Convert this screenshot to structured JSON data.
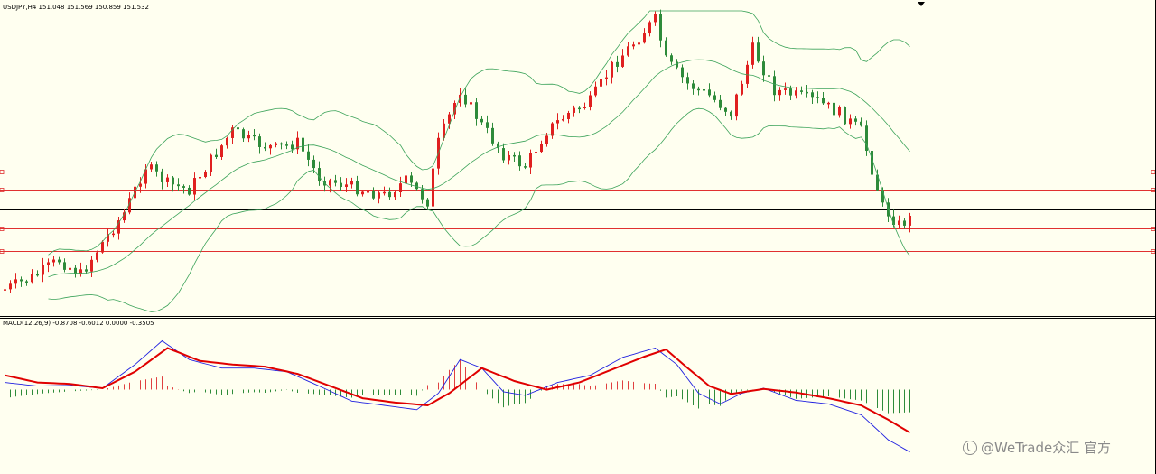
{
  "main_pane": {
    "title": "USDJPY,H4  151.048 151.569 150.859 151.532"
  },
  "macd_pane": {
    "title": "MACD(12,26,9) -0.8708 -0.6012 0.0000 -0.3505"
  },
  "watermark": {
    "text": "@WeTrade众汇 官方",
    "icon": "wetrade-logo-icon"
  },
  "colors": {
    "background": "#fffff0",
    "bull_candle": "#e02020",
    "bear_candle": "#2e8b3a",
    "bollinger": "#3ca35a",
    "level_line": "#e03030",
    "current_price_line": "#000000",
    "macd_line": "#2020e0",
    "signal_line": "#e00000",
    "hist_pos": "#e04040",
    "hist_neg": "#2e8b3a"
  },
  "chart_data": [
    {
      "type": "candlestick",
      "symbol": "USDJPY",
      "timeframe": "H4",
      "ohlc_last": {
        "open": 151.048,
        "high": 151.569,
        "low": 150.859,
        "close": 151.532
      },
      "overlay": "Bollinger Bands",
      "horizontal_levels_px_tags": [
        "level-1",
        "level-2",
        "current-price",
        "level-3",
        "level-4"
      ],
      "trend_path": [
        {
          "t": 0,
          "c": 0.06
        },
        {
          "t": 5,
          "c": 0.1
        },
        {
          "t": 10,
          "c": 0.16
        },
        {
          "t": 14,
          "c": 0.11
        },
        {
          "t": 18,
          "c": 0.22
        },
        {
          "t": 22,
          "c": 0.32
        },
        {
          "t": 26,
          "c": 0.48
        },
        {
          "t": 30,
          "c": 0.42
        },
        {
          "t": 34,
          "c": 0.4
        },
        {
          "t": 38,
          "c": 0.5
        },
        {
          "t": 42,
          "c": 0.6
        },
        {
          "t": 46,
          "c": 0.56
        },
        {
          "t": 50,
          "c": 0.54
        },
        {
          "t": 54,
          "c": 0.56
        },
        {
          "t": 58,
          "c": 0.44
        },
        {
          "t": 62,
          "c": 0.42
        },
        {
          "t": 66,
          "c": 0.4
        },
        {
          "t": 70,
          "c": 0.38
        },
        {
          "t": 74,
          "c": 0.43
        },
        {
          "t": 78,
          "c": 0.36
        },
        {
          "t": 80,
          "c": 0.56
        },
        {
          "t": 84,
          "c": 0.74
        },
        {
          "t": 88,
          "c": 0.62
        },
        {
          "t": 92,
          "c": 0.52
        },
        {
          "t": 96,
          "c": 0.48
        },
        {
          "t": 100,
          "c": 0.6
        },
        {
          "t": 104,
          "c": 0.66
        },
        {
          "t": 108,
          "c": 0.7
        },
        {
          "t": 112,
          "c": 0.82
        },
        {
          "t": 116,
          "c": 0.9
        },
        {
          "t": 120,
          "c": 0.98
        },
        {
          "t": 122,
          "c": 0.84
        },
        {
          "t": 126,
          "c": 0.76
        },
        {
          "t": 130,
          "c": 0.72
        },
        {
          "t": 134,
          "c": 0.66
        },
        {
          "t": 138,
          "c": 0.88
        },
        {
          "t": 142,
          "c": 0.74
        },
        {
          "t": 146,
          "c": 0.72
        },
        {
          "t": 150,
          "c": 0.7
        },
        {
          "t": 154,
          "c": 0.66
        },
        {
          "t": 158,
          "c": 0.6
        },
        {
          "t": 162,
          "c": 0.34
        },
        {
          "t": 165,
          "c": 0.28
        },
        {
          "t": 167,
          "c": 0.3
        }
      ]
    },
    {
      "type": "line+histogram",
      "indicator": "MACD",
      "params": [
        12,
        26,
        9
      ],
      "values": {
        "macd": -0.8708,
        "signal": -0.6012,
        "hist": -0.3505
      },
      "macd_path": [
        {
          "t": 0,
          "v": 0.1
        },
        {
          "t": 6,
          "v": 0.05
        },
        {
          "t": 12,
          "v": 0.06
        },
        {
          "t": 18,
          "v": 0.02
        },
        {
          "t": 24,
          "v": 0.35
        },
        {
          "t": 29,
          "v": 0.68
        },
        {
          "t": 34,
          "v": 0.42
        },
        {
          "t": 40,
          "v": 0.3
        },
        {
          "t": 46,
          "v": 0.3
        },
        {
          "t": 52,
          "v": 0.25
        },
        {
          "t": 58,
          "v": 0.05
        },
        {
          "t": 64,
          "v": -0.16
        },
        {
          "t": 70,
          "v": -0.22
        },
        {
          "t": 76,
          "v": -0.28
        },
        {
          "t": 80,
          "v": -0.05
        },
        {
          "t": 84,
          "v": 0.42
        },
        {
          "t": 88,
          "v": 0.3
        },
        {
          "t": 92,
          "v": -0.03
        },
        {
          "t": 96,
          "v": -0.08
        },
        {
          "t": 102,
          "v": 0.1
        },
        {
          "t": 108,
          "v": 0.2
        },
        {
          "t": 114,
          "v": 0.45
        },
        {
          "t": 120,
          "v": 0.58
        },
        {
          "t": 124,
          "v": 0.35
        },
        {
          "t": 128,
          "v": -0.05
        },
        {
          "t": 132,
          "v": -0.2
        },
        {
          "t": 136,
          "v": -0.05
        },
        {
          "t": 140,
          "v": 0.02
        },
        {
          "t": 146,
          "v": -0.15
        },
        {
          "t": 152,
          "v": -0.2
        },
        {
          "t": 158,
          "v": -0.35
        },
        {
          "t": 163,
          "v": -0.7
        },
        {
          "t": 167,
          "v": -0.87
        }
      ],
      "signal_path": [
        {
          "t": 0,
          "v": 0.2
        },
        {
          "t": 6,
          "v": 0.1
        },
        {
          "t": 12,
          "v": 0.08
        },
        {
          "t": 18,
          "v": 0.02
        },
        {
          "t": 24,
          "v": 0.25
        },
        {
          "t": 30,
          "v": 0.58
        },
        {
          "t": 36,
          "v": 0.4
        },
        {
          "t": 42,
          "v": 0.35
        },
        {
          "t": 48,
          "v": 0.32
        },
        {
          "t": 54,
          "v": 0.22
        },
        {
          "t": 60,
          "v": 0.05
        },
        {
          "t": 66,
          "v": -0.12
        },
        {
          "t": 72,
          "v": -0.18
        },
        {
          "t": 78,
          "v": -0.22
        },
        {
          "t": 82,
          "v": -0.05
        },
        {
          "t": 88,
          "v": 0.3
        },
        {
          "t": 94,
          "v": 0.12
        },
        {
          "t": 100,
          "v": 0.0
        },
        {
          "t": 106,
          "v": 0.1
        },
        {
          "t": 112,
          "v": 0.28
        },
        {
          "t": 118,
          "v": 0.46
        },
        {
          "t": 122,
          "v": 0.56
        },
        {
          "t": 126,
          "v": 0.3
        },
        {
          "t": 130,
          "v": 0.05
        },
        {
          "t": 134,
          "v": -0.06
        },
        {
          "t": 140,
          "v": 0.01
        },
        {
          "t": 146,
          "v": -0.04
        },
        {
          "t": 152,
          "v": -0.12
        },
        {
          "t": 158,
          "v": -0.22
        },
        {
          "t": 163,
          "v": -0.42
        },
        {
          "t": 167,
          "v": -0.6
        }
      ],
      "ylim": [
        -1.0,
        0.8
      ]
    }
  ]
}
